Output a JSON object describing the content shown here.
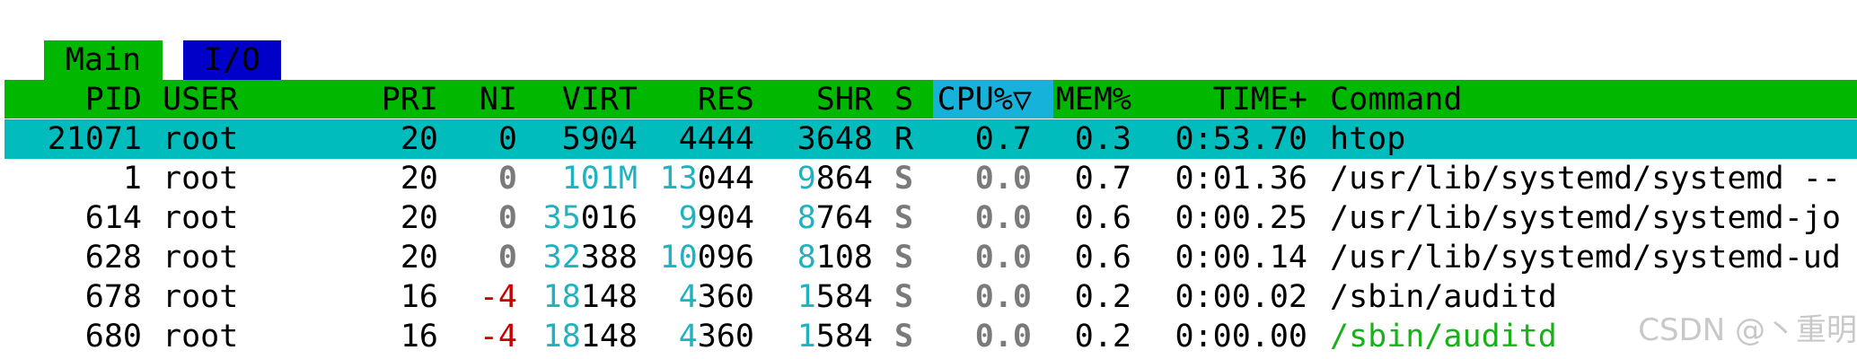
{
  "tabs": {
    "main": "Main",
    "io": "I/O"
  },
  "header": {
    "pid": "PID",
    "user": "USER",
    "pri": "PRI",
    "ni": "NI",
    "virt": "VIRT",
    "res": "RES",
    "shr": "SHR",
    "state": "S",
    "cpu": "CPU%▽",
    "mem": "MEM%",
    "time": "TIME+",
    "command": "Command"
  },
  "processes": [
    {
      "pid": "21071",
      "user": "root",
      "pri": "20",
      "ni": "0",
      "virt_hi": "",
      "virt_lo": "5904",
      "res_hi": "",
      "res_lo": "4444",
      "shr_hi": "",
      "shr_lo": "3648",
      "state": "R",
      "cpu": "0.7",
      "mem": "0.3",
      "time": "0:53.70",
      "command": "htop"
    },
    {
      "pid": "1",
      "user": "root",
      "pri": "20",
      "ni": "0",
      "virt_hi": "101M",
      "virt_lo": "",
      "res_hi": "13",
      "res_lo": "044",
      "shr_hi": "9",
      "shr_lo": "864",
      "state": "S",
      "cpu": "0.0",
      "mem": "0.7",
      "time": "0:01.36",
      "command": "/usr/lib/systemd/systemd --"
    },
    {
      "pid": "614",
      "user": "root",
      "pri": "20",
      "ni": "0",
      "virt_hi": "35",
      "virt_lo": "016",
      "res_hi": "9",
      "res_lo": "904",
      "shr_hi": "8",
      "shr_lo": "764",
      "state": "S",
      "cpu": "0.0",
      "mem": "0.6",
      "time": "0:00.25",
      "command": "/usr/lib/systemd/systemd-jo"
    },
    {
      "pid": "628",
      "user": "root",
      "pri": "20",
      "ni": "0",
      "virt_hi": "32",
      "virt_lo": "388",
      "res_hi": "10",
      "res_lo": "096",
      "shr_hi": "8",
      "shr_lo": "108",
      "state": "S",
      "cpu": "0.0",
      "mem": "0.6",
      "time": "0:00.14",
      "command": "/usr/lib/systemd/systemd-ud"
    },
    {
      "pid": "678",
      "user": "root",
      "pri": "16",
      "ni": "-4",
      "virt_hi": "18",
      "virt_lo": "148",
      "res_hi": "4",
      "res_lo": "360",
      "shr_hi": "1",
      "shr_lo": "584",
      "state": "S",
      "cpu": "0.0",
      "mem": "0.2",
      "time": "0:00.02",
      "command": "/sbin/auditd"
    },
    {
      "pid": "680",
      "user": "root",
      "pri": "16",
      "ni": "-4",
      "virt_hi": "18",
      "virt_lo": "148",
      "res_hi": "4",
      "res_lo": "360",
      "shr_hi": "1",
      "shr_lo": "584",
      "state": "S",
      "cpu": "0.0",
      "mem": "0.2",
      "time": "0:00.00",
      "command": "/sbin/auditd"
    }
  ],
  "watermark": "CSDN @丶重明",
  "colors": {
    "header_bg": "#00b800",
    "tab_main_bg": "#00b800",
    "tab_io_bg": "#0000c8",
    "selected_bg": "#00bcbc",
    "sort_col_bg": "#17b2d9",
    "highlight_digits": "#1fb2c0",
    "negative_nice": "#c80000",
    "thread_green": "#1ab01a",
    "dim_gray": "#7a7a7a"
  }
}
